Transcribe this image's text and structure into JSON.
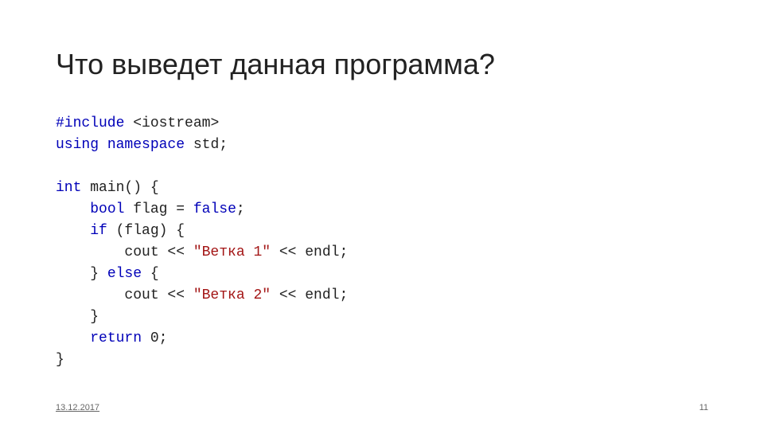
{
  "title": "Что выведет данная программа?",
  "code": {
    "include_kw": "#include",
    "include_hdr": " <iostream>",
    "using_kw": "using",
    "namespace_kw": " namespace",
    "std_txt": " std;",
    "int_kw": "int",
    "main_txt": " main() {",
    "bool_kw": "bool",
    "flag_decl": " flag = ",
    "false_kw": "false",
    "semicolon": ";",
    "if_kw": "if",
    "if_cond": " (flag) {",
    "cout1_pre": "        cout << ",
    "str1": "\"Ветка 1\"",
    "cout1_post": " << endl;",
    "else_line": "    } ",
    "else_kw": "else",
    "else_brace": " {",
    "cout2_pre": "        cout << ",
    "str2": "\"Ветка 2\"",
    "cout2_post": " << endl;",
    "close_inner": "    }",
    "return_kw": "return",
    "return_val": " 0;",
    "close_main": "}"
  },
  "footer": {
    "date": "13.12.2017",
    "page": "11"
  }
}
